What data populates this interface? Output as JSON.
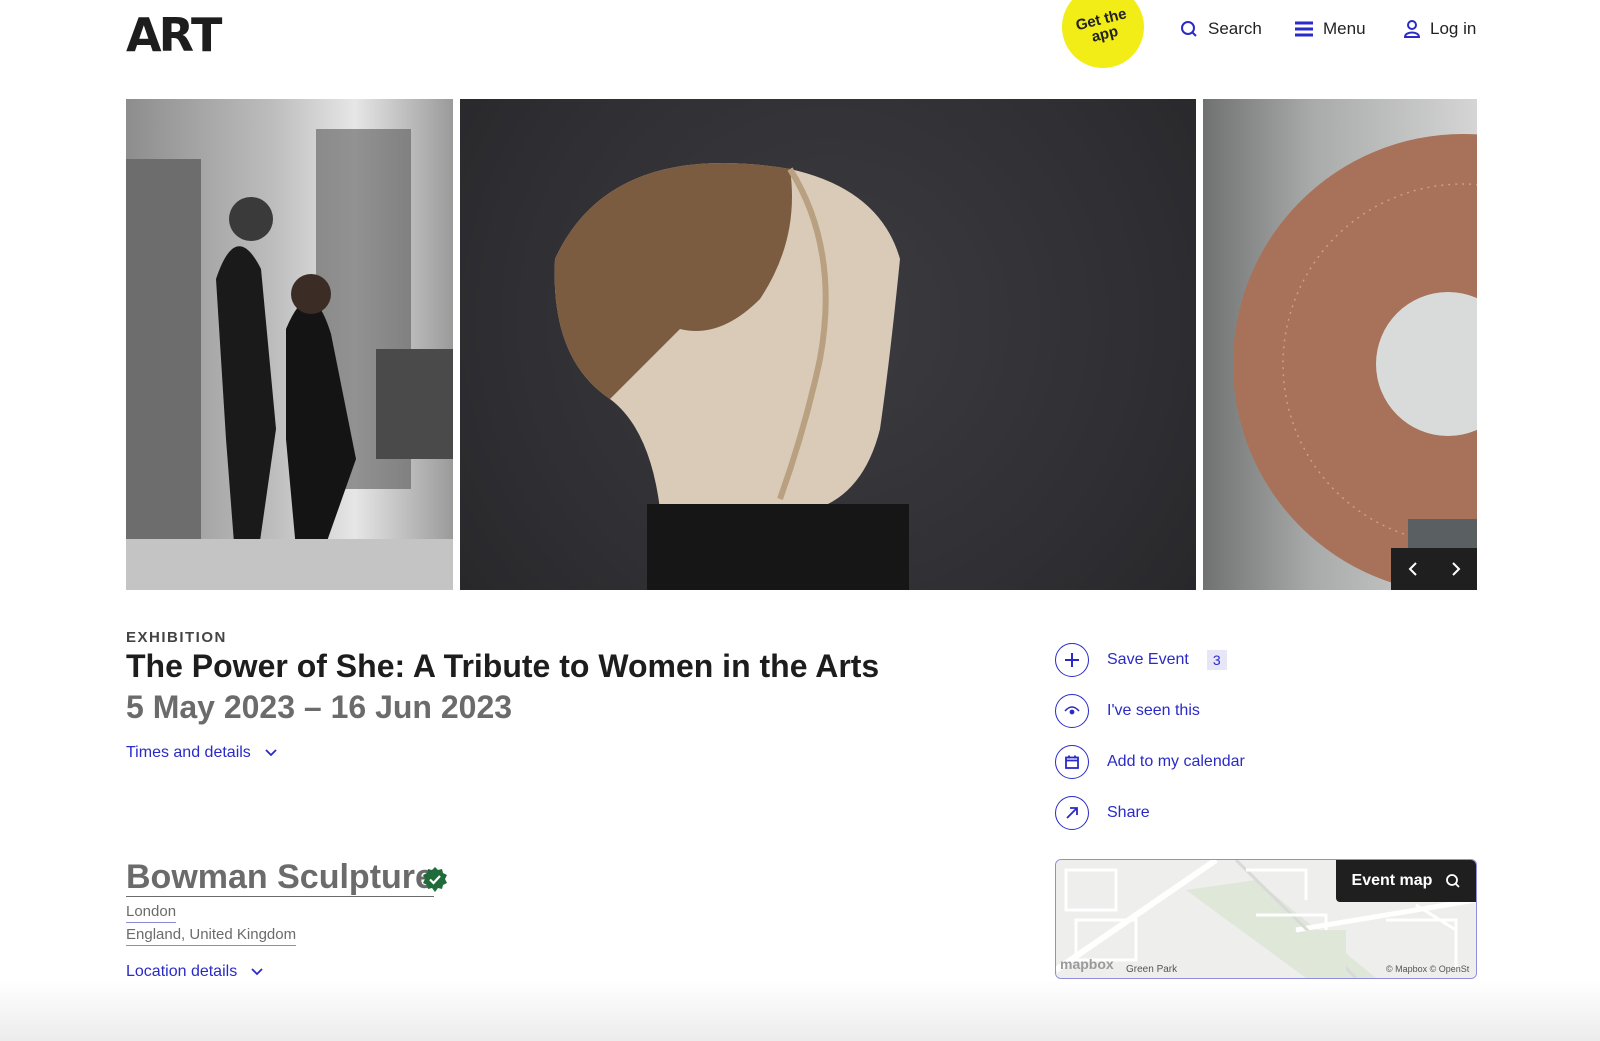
{
  "header": {
    "logo": "ARТ",
    "app_badge": "Get the app",
    "search_label": "Search",
    "menu_label": "Menu",
    "login_label": "Log in"
  },
  "event": {
    "kicker": "EXHIBITION",
    "title": "The Power of She: A Tribute to Women in the Arts",
    "dates": "5 May 2023 – 16 Jun 2023",
    "times_details_label": "Times and details"
  },
  "venue": {
    "name": "Bowman Sculpture",
    "city": "London",
    "region": "England, United Kingdom",
    "location_details_label": "Location details"
  },
  "actions": {
    "save_label": "Save Event",
    "save_count": "3",
    "seen_label": "I've seen this",
    "calendar_label": "Add to my calendar",
    "share_label": "Share"
  },
  "map": {
    "button_label": "Event map",
    "mapbox_label": "mapbox",
    "park_label": "Green Park",
    "attribution": "© Mapbox © OpenSt",
    "colors": {
      "park": "#dfe7d9",
      "roads": "#ffffff"
    }
  },
  "colors": {
    "accent": "#2a2ac9",
    "badge": "#f2ed17",
    "verified": "#1f6b3a"
  }
}
